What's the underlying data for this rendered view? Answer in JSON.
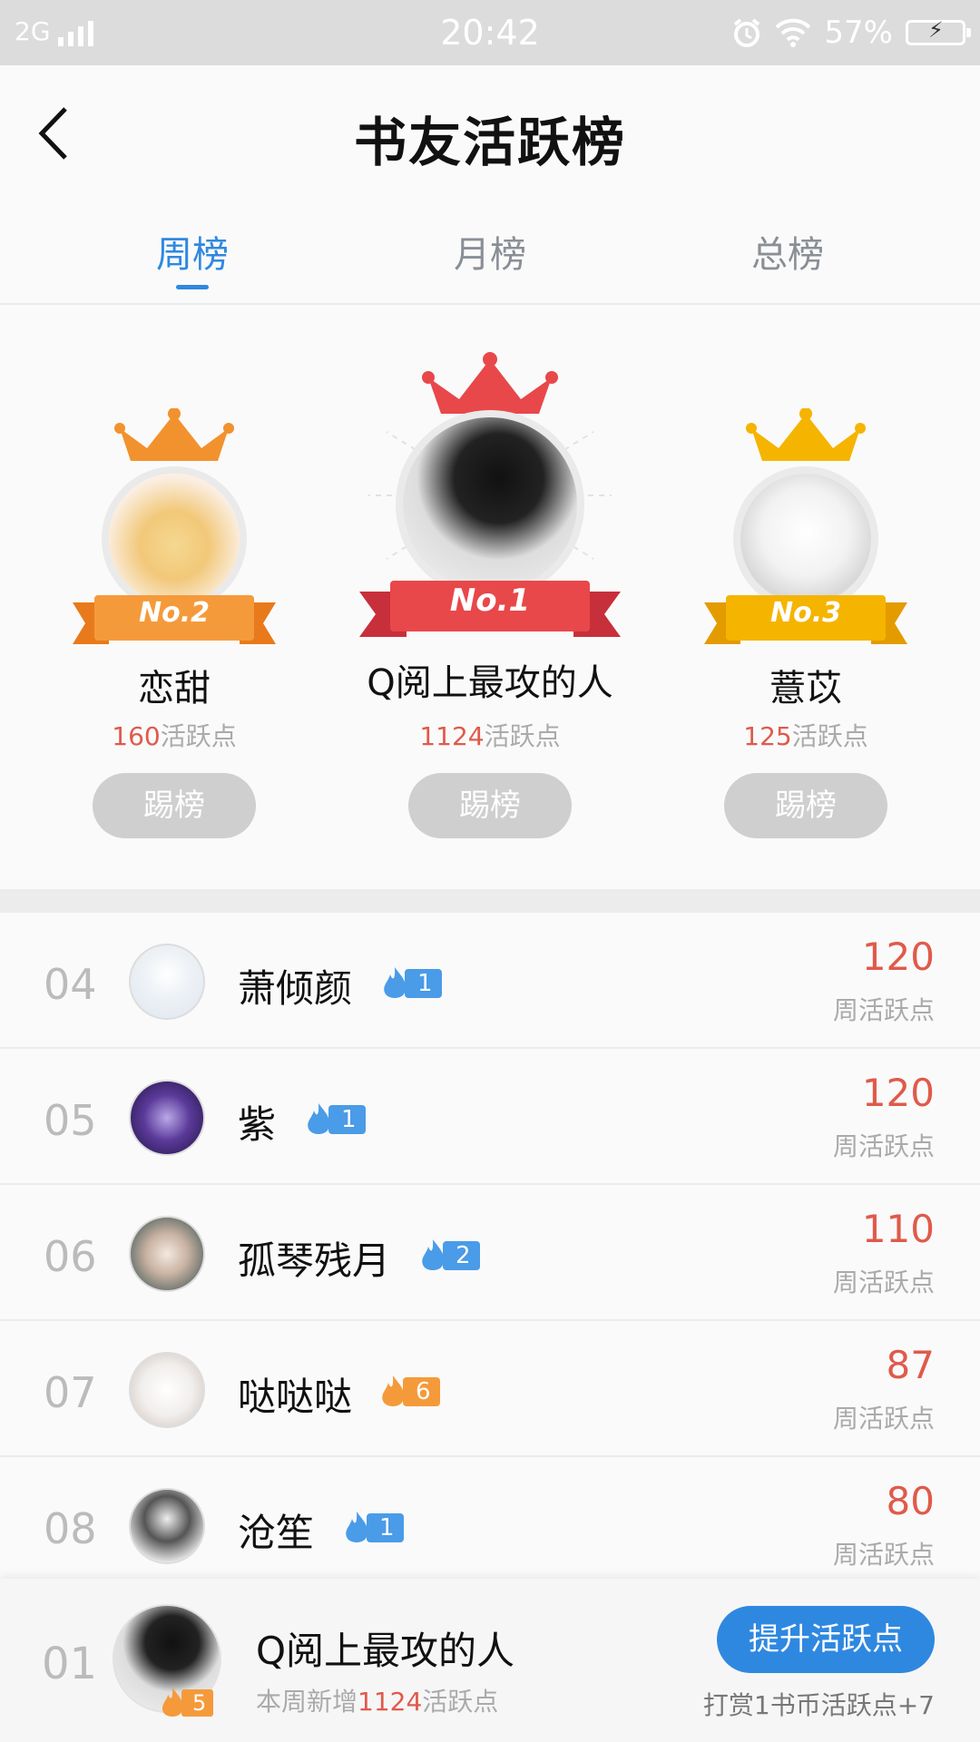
{
  "status_bar": {
    "network": "2G",
    "time": "20:42",
    "battery": "57%"
  },
  "header": {
    "title": "书友活跃榜",
    "back_icon": "chevron-left-icon"
  },
  "tabs": [
    {
      "label": "周榜",
      "active": true
    },
    {
      "label": "月榜",
      "active": false
    },
    {
      "label": "总榜",
      "active": false
    }
  ],
  "podium": {
    "first": {
      "badge": "No.1",
      "name": "Q阅上最攻的人",
      "points": "1124",
      "points_unit": "活跃点",
      "button": "踢榜",
      "crown_color": "#e8484a"
    },
    "second": {
      "badge": "No.2",
      "name": "恋甜",
      "points": "160",
      "points_unit": "活跃点",
      "button": "踢榜",
      "crown_color": "#f2922e"
    },
    "third": {
      "badge": "No.3",
      "name": "薏苡",
      "points": "125",
      "points_unit": "活跃点",
      "button": "踢榜",
      "crown_color": "#f5b400"
    }
  },
  "list": [
    {
      "rank": "04",
      "name": "萧倾颜",
      "level": "1",
      "level_color": "blue",
      "score": "120",
      "score_label": "周活跃点"
    },
    {
      "rank": "05",
      "name": "紫",
      "level": "1",
      "level_color": "blue",
      "score": "120",
      "score_label": "周活跃点"
    },
    {
      "rank": "06",
      "name": "孤琴残月",
      "level": "2",
      "level_color": "blue",
      "score": "110",
      "score_label": "周活跃点"
    },
    {
      "rank": "07",
      "name": "哒哒哒",
      "level": "6",
      "level_color": "orange",
      "score": "87",
      "score_label": "周活跃点"
    },
    {
      "rank": "08",
      "name": "沧笙",
      "level": "1",
      "level_color": "blue",
      "score": "80",
      "score_label": "周活跃点"
    }
  ],
  "me": {
    "rank": "01",
    "name": "Q阅上最攻的人",
    "level": "5",
    "sub_prefix": "本周新增",
    "sub_points": "1124",
    "sub_suffix": "活跃点",
    "button": "提升活跃点",
    "tip": "打赏1书币活跃点+7"
  },
  "colors": {
    "accent": "#2f88e0",
    "score_red": "#e05a4b"
  }
}
